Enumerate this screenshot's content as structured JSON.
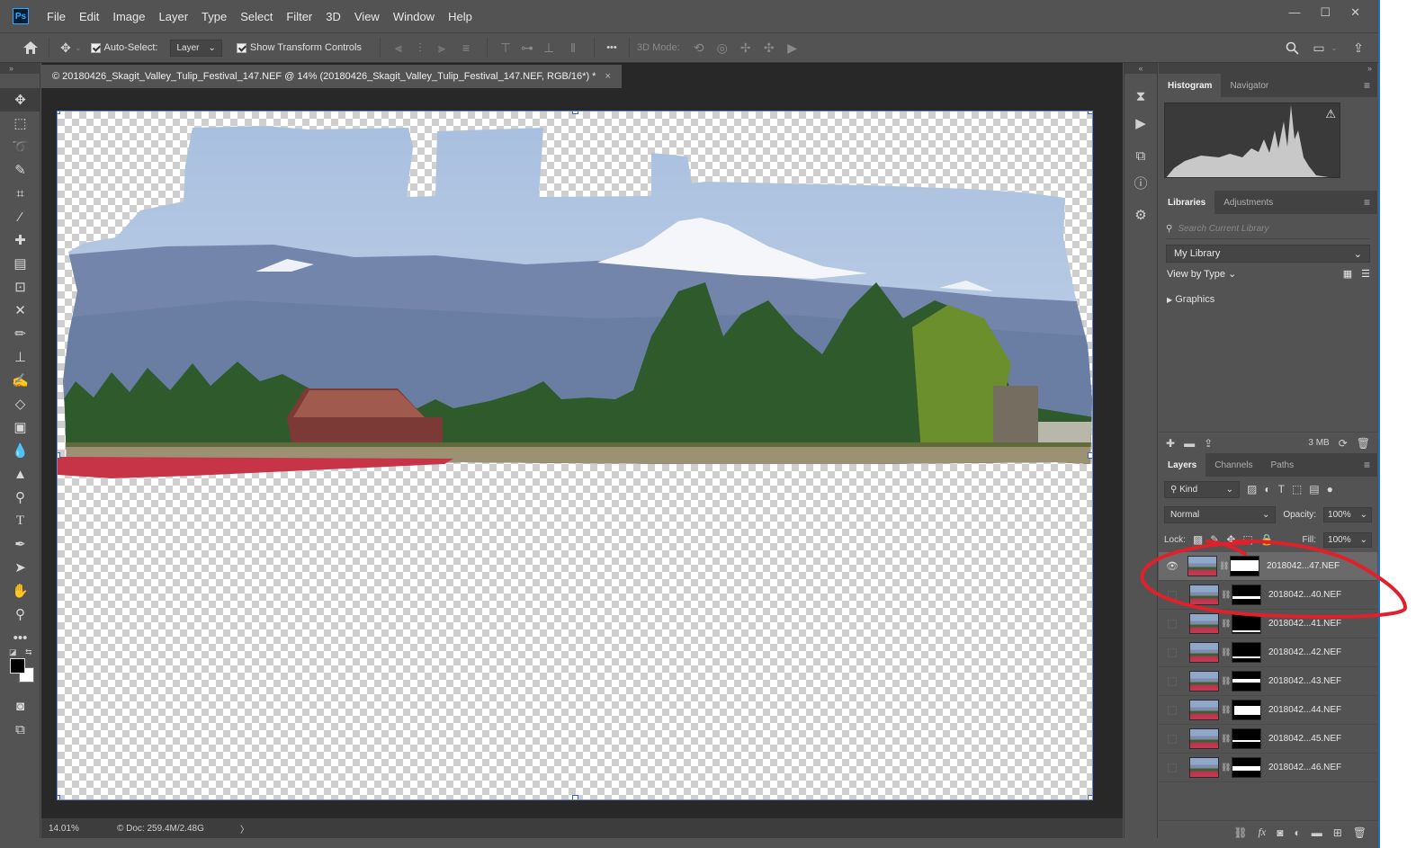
{
  "app": {
    "logo": "Ps"
  },
  "menu": [
    "File",
    "Edit",
    "Image",
    "Layer",
    "Type",
    "Select",
    "Filter",
    "3D",
    "View",
    "Window",
    "Help"
  ],
  "window_controls": {
    "minimize": "—",
    "maximize": "☐",
    "close": "✕"
  },
  "options": {
    "auto_select_label": "Auto-Select:",
    "auto_select_checked": true,
    "auto_select_value": "Layer",
    "show_transform_label": "Show Transform Controls",
    "show_transform_checked": true,
    "mode_3d_label": "3D Mode:",
    "more": "•••"
  },
  "document": {
    "tab_title": "© 20180426_Skagit_Valley_Tulip_Festival_147.NEF @ 14% (20180426_Skagit_Valley_Tulip_Festival_147.NEF, RGB/16*) *",
    "close": "×"
  },
  "status": {
    "zoom": "14.01%",
    "doc_info": "© Doc: 259.4M/2.48G",
    "arrow": "〉"
  },
  "histogram_panel": {
    "tabs": [
      "Histogram",
      "Navigator"
    ],
    "active": "Histogram",
    "warning": "⚠"
  },
  "libraries_panel": {
    "tabs": [
      "Libraries",
      "Adjustments"
    ],
    "active": "Libraries",
    "search_placeholder": "Search Current Library",
    "library": "My Library",
    "view_by": "View by Type",
    "group": "Graphics",
    "size": "3 MB"
  },
  "layers_panel": {
    "tabs": [
      "Layers",
      "Channels",
      "Paths"
    ],
    "active": "Layers",
    "filter_kind": "Kind",
    "blend_mode": "Normal",
    "opacity_label": "Opacity:",
    "opacity_value": "100%",
    "lock_label": "Lock:",
    "fill_label": "Fill:",
    "fill_value": "100%",
    "layers": [
      {
        "name": "2018042...47.NEF",
        "visible": true,
        "selected": true
      },
      {
        "name": "2018042...40.NEF",
        "visible": false,
        "selected": false
      },
      {
        "name": "2018042...41.NEF",
        "visible": false,
        "selected": false
      },
      {
        "name": "2018042...42.NEF",
        "visible": false,
        "selected": false
      },
      {
        "name": "2018042...43.NEF",
        "visible": false,
        "selected": false
      },
      {
        "name": "2018042...44.NEF",
        "visible": false,
        "selected": false
      },
      {
        "name": "2018042...45.NEF",
        "visible": false,
        "selected": false
      },
      {
        "name": "2018042...46.NEF",
        "visible": false,
        "selected": false
      }
    ]
  },
  "colors": {
    "accent": "#31a8ff",
    "annotation": "#e0202a",
    "selection": "#3f63c6"
  }
}
